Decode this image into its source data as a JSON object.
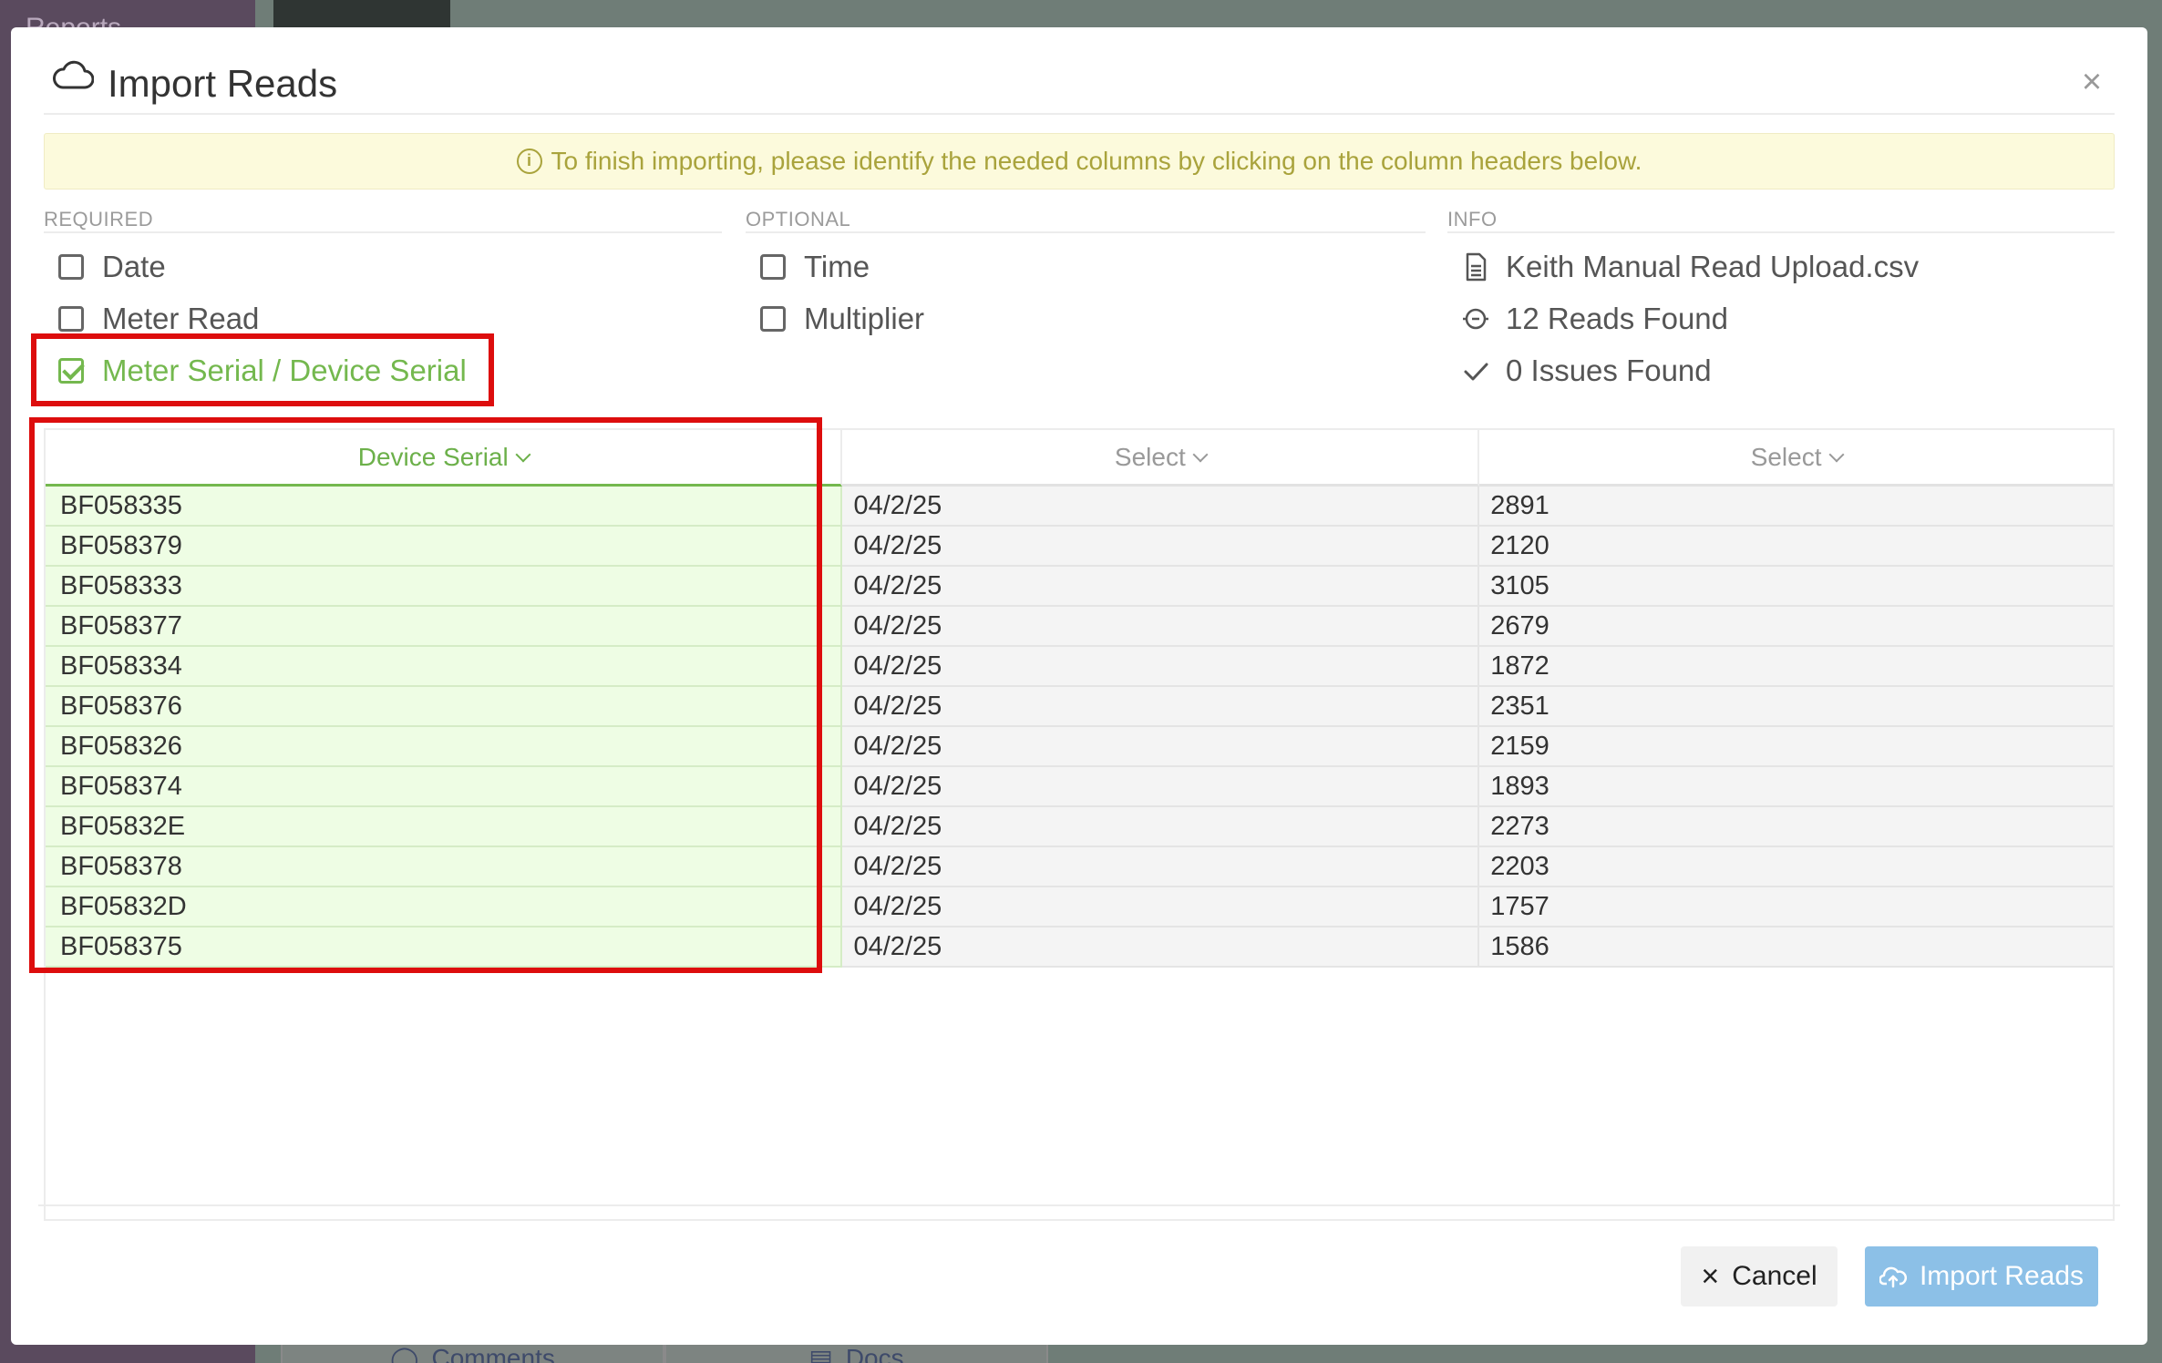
{
  "background": {
    "sidebar_label": "Reports",
    "tabs": [
      {
        "label": "Comments",
        "icon": "comment-icon"
      },
      {
        "label": "Docs",
        "icon": "document-icon"
      }
    ]
  },
  "modal": {
    "title": "Import Reads",
    "title_icon": "cloud-icon",
    "close_label": "×",
    "banner": "To finish importing, please identify the needed columns by clicking on the column headers below.",
    "required": {
      "heading": "REQUIRED",
      "items": [
        {
          "label": "Date",
          "checked": false
        },
        {
          "label": "Meter Read",
          "checked": false
        },
        {
          "label": "Meter Serial / Device Serial",
          "checked": true
        }
      ]
    },
    "optional": {
      "heading": "OPTIONAL",
      "items": [
        {
          "label": "Time",
          "checked": false
        },
        {
          "label": "Multiplier",
          "checked": false
        }
      ]
    },
    "info": {
      "heading": "INFO",
      "items": [
        {
          "label": "Keith Manual Read Upload.csv",
          "icon": "file-icon"
        },
        {
          "label": "12 Reads Found",
          "icon": "search-icon"
        },
        {
          "label": "0 Issues Found",
          "icon": "checkmark-icon"
        }
      ]
    },
    "table": {
      "headers": [
        "Device Serial",
        "Select",
        "Select"
      ],
      "rows": [
        [
          "BF058335",
          "04/2/25",
          "2891"
        ],
        [
          "BF058379",
          "04/2/25",
          "2120"
        ],
        [
          "BF058333",
          "04/2/25",
          "3105"
        ],
        [
          "BF058377",
          "04/2/25",
          "2679"
        ],
        [
          "BF058334",
          "04/2/25",
          "1872"
        ],
        [
          "BF058376",
          "04/2/25",
          "2351"
        ],
        [
          "BF058326",
          "04/2/25",
          "2159"
        ],
        [
          "BF058374",
          "04/2/25",
          "1893"
        ],
        [
          "BF05832E",
          "04/2/25",
          "2273"
        ],
        [
          "BF058378",
          "04/2/25",
          "2203"
        ],
        [
          "BF05832D",
          "04/2/25",
          "1757"
        ],
        [
          "BF058375",
          "04/2/25",
          "1586"
        ]
      ]
    },
    "buttons": {
      "cancel": "Cancel",
      "import": "Import Reads"
    },
    "colors": {
      "selected_green": "#74b84e",
      "highlight_red": "#dd0d0d",
      "primary_blue": "#8cc0e7",
      "banner_text": "#a9a33c"
    }
  }
}
